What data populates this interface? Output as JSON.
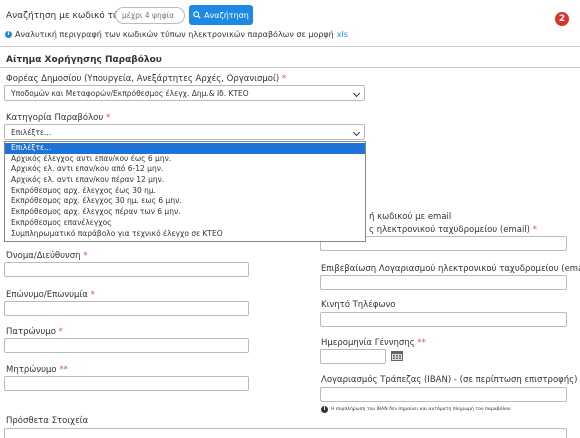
{
  "search": {
    "label": "Αναζήτηση με κωδικό τύπου",
    "placeholder": "μέχρι 4 ψηφία",
    "button_label": "Αναζήτηση",
    "info_text": "Αναλυτική περιγραφή των κωδικών τύπων ηλεκτρονικών παραβόλων σε μορφή",
    "xls_link": "xls"
  },
  "badge": {
    "value": "2"
  },
  "form": {
    "section_title": "Αίτημα Χορήγησης Παραβόλου",
    "agency": {
      "label": "Φορέας Δημοσίου (Υπουργεία, Ανεξάρτητες Αρχές, Οργανισμοί)",
      "required_mark": "*",
      "value": "Υποδομών και Μεταφορών/Εκπρόθεσμος έλεγχ. Δημ.& Ιδ. ΚΤΕΟ"
    },
    "category": {
      "label": "Κατηγορία Παραβόλου",
      "required_mark": "*",
      "value": "Επιλέξτε...",
      "options": [
        "Επιλέξτε...",
        "Αρχικός έλεγχος αντι επαν/κου έως 6 μην.",
        "Αρχικός ελ. αντι επαν/κου από 6-12 μην.",
        "Αρχικός ελ. αντι επαν/κου πέραν 12 μην.",
        "Εκπρόθεσμος αρχ. έλεγχος έως 30 ημ.",
        "Εκπρόθεσμος αρχ. έλεγχος 30 ημ. εως 6 μην.",
        "Εκπρόθεσμος αρχ. έλεγχος πέραν των 6 μην.",
        "Εκπρόθεσμος επανέλεγχος",
        "Συμπληρωματικό παράβολο για τεχνικό έλεγχο σε ΚΤΕΟ"
      ],
      "selected_index": 0
    },
    "left": {
      "name_label": "Όνομα/Διεύθυνση",
      "name_mark": "*",
      "surname_label": "Επώνυμο/Επωνυμία",
      "surname_mark": "*",
      "father_label": "Πατρώνυμο",
      "father_mark": "*",
      "mother_label": "Μητρώνυμο",
      "mother_mark": "**"
    },
    "right": {
      "email_code_text": "ή κωδικού με email",
      "email_label_partial": "ς ηλεκτρονικού ταχυδρομείου (email)",
      "email_mark": "*",
      "email_confirm_label": "Επιβεβαίωση Λογαριασμού ηλεκτρονικού ταχυδρομείου (email)",
      "mobile_label": "Κινητό Τηλέφωνο",
      "birth_label": "Ημερομηνία Γέννησης",
      "birth_mark": "**",
      "iban_label": "Λογαριασμός Τράπεζας (IBAN) - (σε περίπτωση επιστροφής)",
      "iban_note": "Η συμπλήρωση του IBAN δεν σημαίνει και αυτόματη πληρωμή του παραβόλου"
    },
    "extra_label": "Πρόσθετα Στοιχεία"
  },
  "colors": {
    "primary": "#1e88e5",
    "badge": "#d9342b",
    "dropdown_active": "#1e73d8",
    "required": "#d9534f"
  },
  "icons": [
    "search-icon",
    "info-icon",
    "calendar-icon",
    "chevron-down-icon"
  ]
}
